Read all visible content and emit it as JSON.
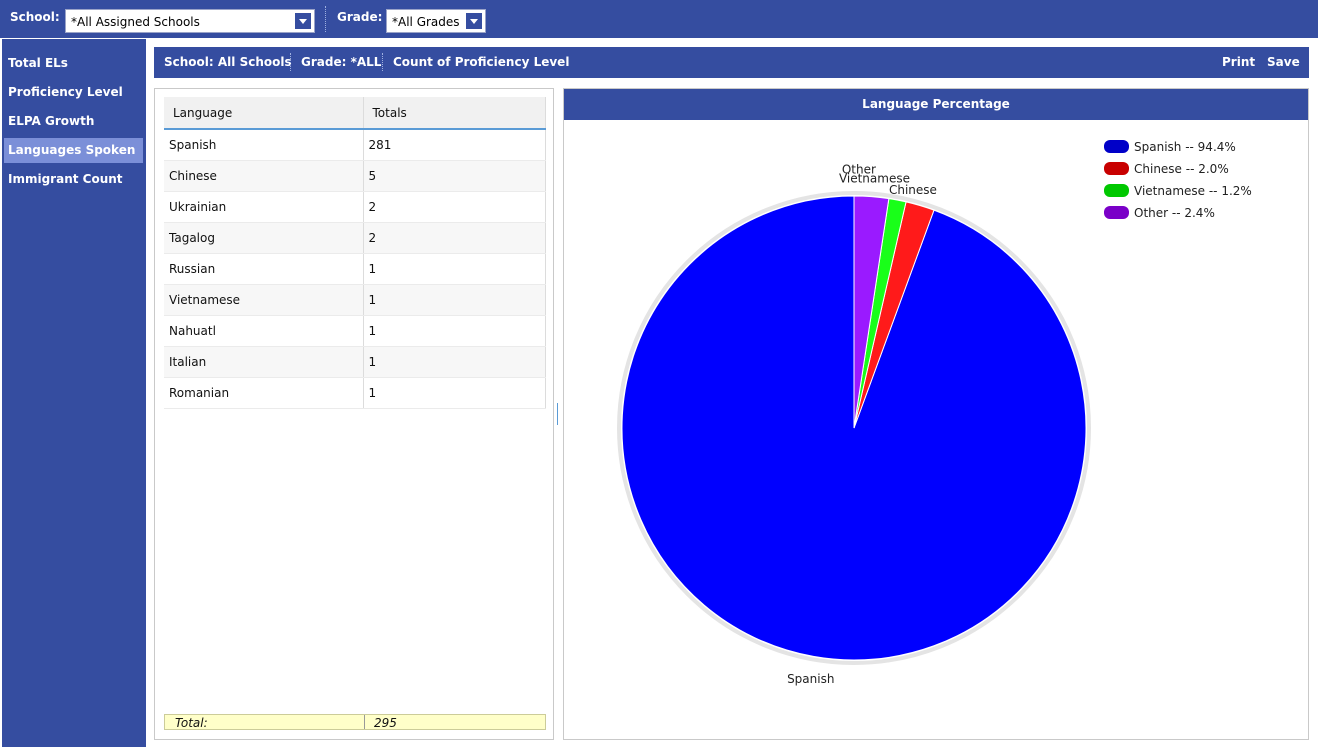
{
  "topbar": {
    "school_label": "School:",
    "school_value": "*All Assigned Schools",
    "grade_label": "Grade:",
    "grade_value": "*All Grades"
  },
  "sidebar": {
    "items": [
      {
        "label": "Total ELs"
      },
      {
        "label": "Proficiency Level"
      },
      {
        "label": "ELPA Growth"
      },
      {
        "label": "Languages Spoken",
        "active": true
      },
      {
        "label": "Immigrant Count"
      }
    ]
  },
  "content_header": {
    "school": "School: All Schools",
    "grade": "Grade: *ALL",
    "report": "Count of Proficiency Level",
    "print_label": "Print",
    "save_label": "Save"
  },
  "table": {
    "columns": [
      "Language",
      "Totals"
    ],
    "rows": [
      [
        "Spanish",
        "281"
      ],
      [
        "Chinese",
        "5"
      ],
      [
        "Ukrainian",
        "2"
      ],
      [
        "Tagalog",
        "2"
      ],
      [
        "Russian",
        "1"
      ],
      [
        "Vietnamese",
        "1"
      ],
      [
        "Nahuatl",
        "1"
      ],
      [
        "Italian",
        "1"
      ],
      [
        "Romanian",
        "1"
      ]
    ],
    "total_label": "Total:",
    "total_value": "295"
  },
  "chart_data": {
    "type": "pie",
    "title": "Language Percentage",
    "categories": [
      "Spanish",
      "Chinese",
      "Vietnamese",
      "Other"
    ],
    "values": [
      94.4,
      2.0,
      1.2,
      2.4
    ],
    "legend": [
      "Spanish -- 94.4%",
      "Chinese -- 2.0%",
      "Vietnamese -- 1.2%",
      "Other -- 2.4%"
    ],
    "colors": [
      "#0000ff",
      "#ff1a1a",
      "#19ff19",
      "#9a1aff"
    ],
    "legend_colors": [
      "#0000c8",
      "#c80000",
      "#00c800",
      "#7a00c8"
    ],
    "legend_position": "top-right"
  }
}
